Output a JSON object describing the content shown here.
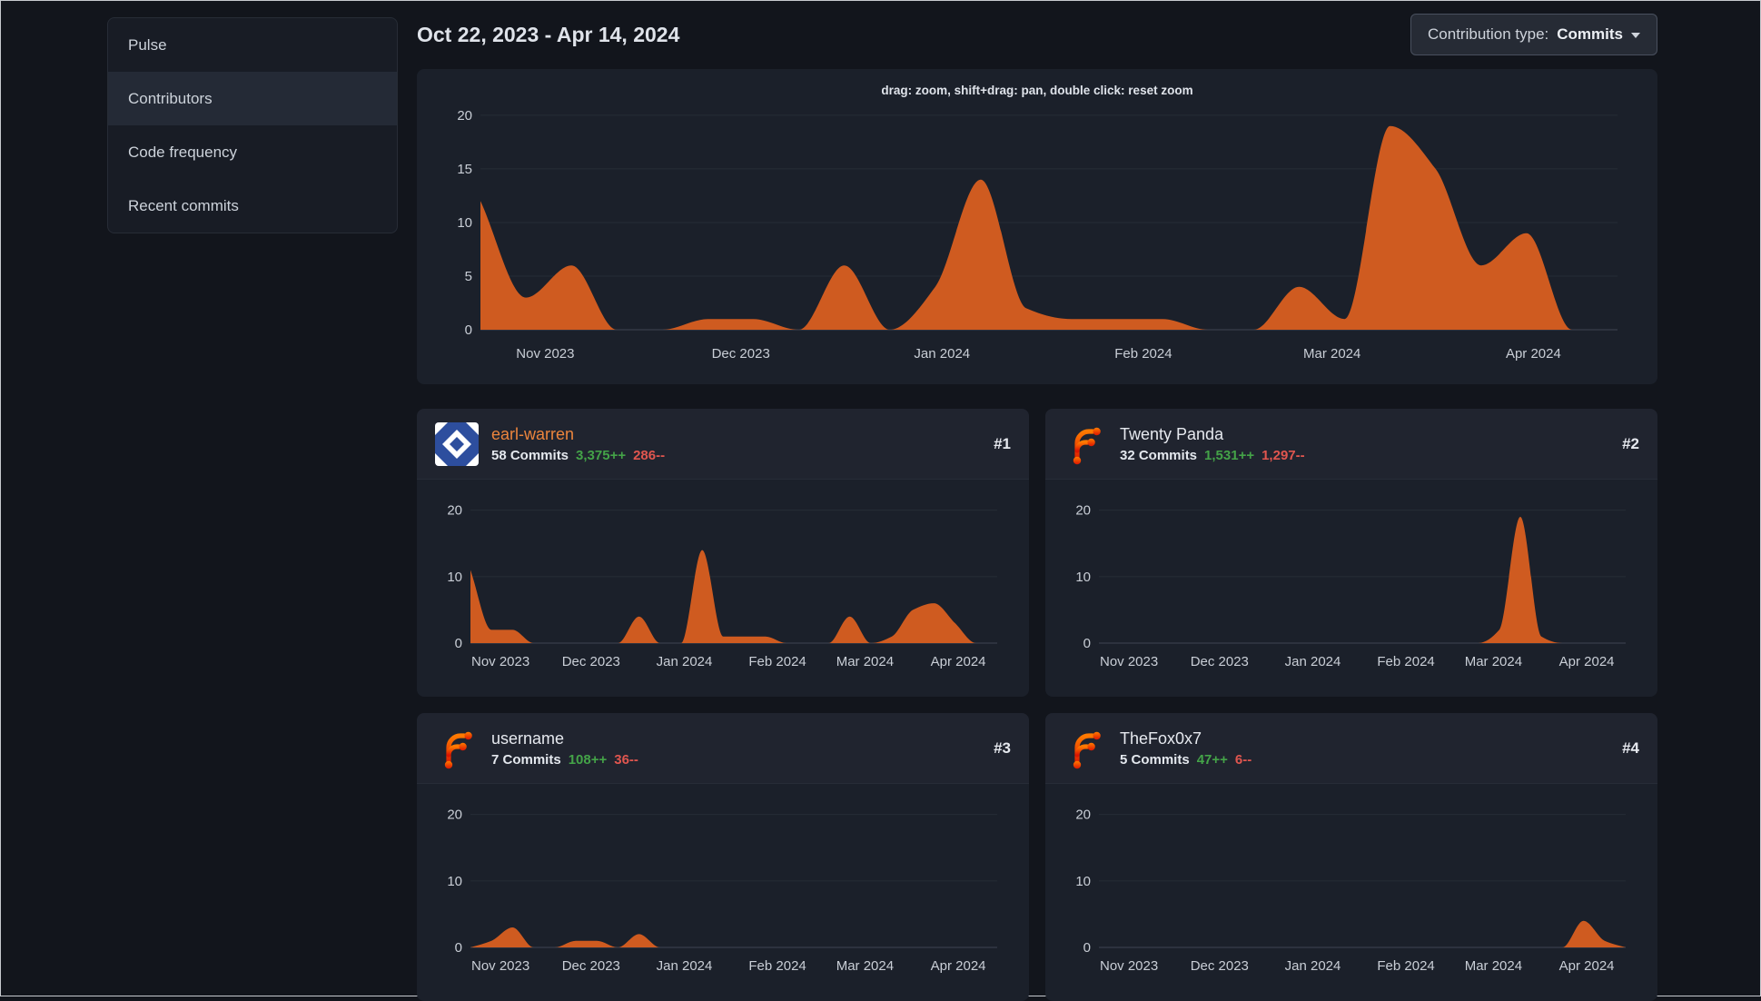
{
  "colors": {
    "accent_orange": "#cf5b20",
    "link_orange": "#ec853d",
    "name_default": "#e6e9ef",
    "green": "#44a348",
    "red": "#e0564f",
    "grid": "#262c36",
    "axis": "#3f4552",
    "tick": "#c9ced6"
  },
  "sidebar": {
    "items": [
      {
        "label": "Pulse"
      },
      {
        "label": "Contributors"
      },
      {
        "label": "Code frequency"
      },
      {
        "label": "Recent commits"
      }
    ],
    "active": "Contributors"
  },
  "header": {
    "date_range": "Oct 22, 2023 - Apr 14, 2024",
    "contribution_type": {
      "label": "Contribution type:",
      "value": "Commits"
    }
  },
  "months": [
    {
      "label": "Nov 2023",
      "pos": 0.057
    },
    {
      "label": "Dec 2023",
      "pos": 0.229
    },
    {
      "label": "Jan 2024",
      "pos": 0.406
    },
    {
      "label": "Feb 2024",
      "pos": 0.583
    },
    {
      "label": "Mar 2024",
      "pos": 0.749
    },
    {
      "label": "Apr 2024",
      "pos": 0.926
    }
  ],
  "main_chart": {
    "type": "area",
    "hint": "drag: zoom, shift+drag: pan, double click: reset zoom",
    "yticks": [
      0,
      5,
      10,
      15,
      20
    ],
    "ymax": 20.5,
    "values": [
      12,
      3,
      6,
      0,
      0,
      1,
      1,
      0,
      6,
      0,
      4,
      14,
      2,
      1,
      1,
      1,
      0,
      0,
      4,
      1,
      19,
      15,
      6,
      9,
      0,
      0
    ]
  },
  "contributors": [
    {
      "rank": "#1",
      "name": "earl-warren",
      "name_color": "#ec853d",
      "commits": "58 Commits",
      "additions": "3,375++",
      "deletions": "286--",
      "avatar": "identicon",
      "chart": {
        "type": "area",
        "yticks": [
          0,
          10,
          20
        ],
        "ymax": 20.5,
        "values": [
          11,
          2,
          2,
          0,
          0,
          0,
          0,
          0,
          4,
          0,
          0,
          14,
          1,
          1,
          1,
          0,
          0,
          0,
          4,
          0,
          1,
          5,
          6,
          3,
          0,
          0
        ]
      }
    },
    {
      "rank": "#2",
      "name": "Twenty Panda",
      "name_color": "#e6e9ef",
      "commits": "32 Commits",
      "additions": "1,531++",
      "deletions": "1,297--",
      "avatar": "forgejo-logo",
      "chart": {
        "type": "area",
        "yticks": [
          0,
          10,
          20
        ],
        "ymax": 20.5,
        "values": [
          0,
          0,
          0,
          0,
          0,
          0,
          0,
          0,
          0,
          0,
          0,
          0,
          0,
          0,
          0,
          0,
          0,
          0,
          0,
          2,
          19,
          1,
          0,
          0,
          0,
          0
        ]
      }
    },
    {
      "rank": "#3",
      "name": "username",
      "name_color": "#e6e9ef",
      "commits": "7 Commits",
      "additions": "108++",
      "deletions": "36--",
      "avatar": "forgejo-logo",
      "chart": {
        "type": "area",
        "yticks": [
          0,
          10,
          20
        ],
        "ymax": 20.5,
        "values": [
          0,
          1,
          3,
          0,
          0,
          1,
          1,
          0,
          2,
          0,
          0,
          0,
          0,
          0,
          0,
          0,
          0,
          0,
          0,
          0,
          0,
          0,
          0,
          0,
          0,
          0
        ]
      }
    },
    {
      "rank": "#4",
      "name": "TheFox0x7",
      "name_color": "#e6e9ef",
      "commits": "5 Commits",
      "additions": "47++",
      "deletions": "6--",
      "avatar": "forgejo-logo",
      "chart": {
        "type": "area",
        "yticks": [
          0,
          10,
          20
        ],
        "ymax": 20.5,
        "values": [
          0,
          0,
          0,
          0,
          0,
          0,
          0,
          0,
          0,
          0,
          0,
          0,
          0,
          0,
          0,
          0,
          0,
          0,
          0,
          0,
          0,
          0,
          0,
          4,
          1,
          0
        ]
      }
    }
  ]
}
